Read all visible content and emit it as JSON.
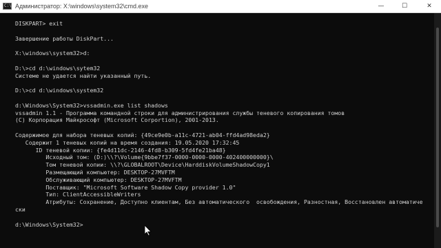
{
  "window": {
    "title": "Администратор: X:\\windows\\system32\\cmd.exe",
    "icon_text": "C:\\",
    "minimize_glyph": "—",
    "maximize_glyph": "☐",
    "close_glyph": "✕"
  },
  "console": {
    "lines": [
      "DISKPART> exit",
      "",
      "Завершение работы DiskPart...",
      "",
      "X:\\windows\\system32>d:",
      "",
      "D:\\>cd d:\\windows\\sytem32",
      "Системе не удается найти указанный путь.",
      "",
      "D:\\>cd d:\\windows\\system32",
      "",
      "d:\\Windows\\System32>vssadmin.exe list shadows",
      "vssadmin 1.1 - Программа командной строки для администрирования службы теневого копирования томов",
      "(C) Корпорация Майкрософт (Microsoft Corportion), 2001-2013.",
      "",
      "Содержимое для набора теневых копий: {49ce9e0b-a11c-4721-ab04-ffd4ad98eda2}",
      "   Содержит 1 теневых копий на время создания: 19.05.2020 17:32:45",
      "      ID теневой копии: {fe4d11dc-2146-4fd8-b309-5fd4fe21ba48}",
      "         Исходный том: (D:)\\\\?\\Volume{9bbe7f37-0000-0000-0000-402400000000}\\",
      "         Том теневой копии: \\\\?\\GLOBALROOT\\Device\\HarddiskVolumeShadowCopy1",
      "         Размещающий компьютер: DESKTOP-27MVFTM",
      "         Обслуживающий компьютер: DESKTOP-27MVFTM",
      "         Поставщик: \"Microsoft Software Shadow Copy provider 1.0\"",
      "         Тип: ClientAccessibleWriters",
      "         Атрибуты: Сохранение, Доступно клиентам, Без автоматического  освобождения, Разностная, Восстановлен автоматиче",
      "ски",
      "",
      "d:\\Windows\\System32>"
    ]
  }
}
